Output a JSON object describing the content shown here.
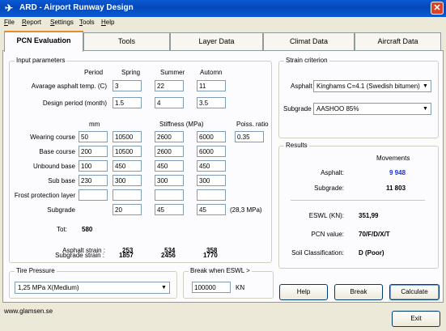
{
  "window": {
    "title": "ARD - Airport Runway Design",
    "close": "✕"
  },
  "menu": [
    "File",
    "Report",
    "Settings",
    "Tools",
    "Help"
  ],
  "tabs": [
    "PCN Evaluation",
    "Tools",
    "Layer Data",
    "Climat Data",
    "Aircraft Data"
  ],
  "input_params": {
    "title": "Input parameters",
    "season_headers": [
      "Period",
      "Spring",
      "Summer",
      "Automn"
    ],
    "avg_temp_label": "Avarage asphalt temp. (C)",
    "avg_temp": [
      "3",
      "22",
      "11"
    ],
    "design_period_label": "Design period (month)",
    "design_period": [
      "1.5",
      "4",
      "3.5"
    ],
    "mm_header": "mm",
    "stiffness_header": "Stiffness (MPa)",
    "poiss_header": "Poiss. ratio",
    "layers": [
      {
        "label": "Wearing course",
        "mm": "50",
        "s": [
          "10500",
          "2600",
          "6000"
        ],
        "poiss": "0.35"
      },
      {
        "label": "Base course",
        "mm": "200",
        "s": [
          "10500",
          "2600",
          "6000"
        ]
      },
      {
        "label": "Unbound base",
        "mm": "100",
        "s": [
          "450",
          "450",
          "450"
        ]
      },
      {
        "label": "Sub base",
        "mm": "230",
        "s": [
          "300",
          "300",
          "300"
        ]
      },
      {
        "label": "Frost protection layer",
        "mm": "",
        "s": [
          "",
          "",
          ""
        ]
      },
      {
        "label": "Subgrade",
        "mm": "",
        "s": [
          "20",
          "45",
          "45"
        ],
        "note": "(28,3 MPa)"
      }
    ],
    "tot_label": "Tot:",
    "tot_value": "580",
    "asphalt_strain_label": "Asphalt strain :",
    "asphalt_strain": [
      "253",
      "534",
      "358"
    ],
    "subgrade_strain_label": "Subgrade strain :",
    "subgrade_strain": [
      "1857",
      "2456",
      "1770"
    ]
  },
  "strain": {
    "title": "Strain criterion",
    "asphalt_label": "Asphalt",
    "asphalt_value": "Kinghams C=4.1 (Swedish bitumen)",
    "subgrade_label": "Subgrade",
    "subgrade_value": "AASHOO 85%"
  },
  "results": {
    "title": "Results",
    "movements_header": "Movements",
    "asphalt_label": "Asphalt:",
    "asphalt_value": "9 948",
    "subgrade_label": "Subgrade:",
    "subgrade_value": "11 803",
    "eswl_label": "ESWL (KN):",
    "eswl_value": "351,99",
    "pcn_label": "PCN value:",
    "pcn_value": "70/F/D/X/T",
    "soil_label": "Soil Classification:",
    "soil_value": "D (Poor)",
    "accent": "#1a2fd6"
  },
  "tire": {
    "title": "Tire Pressure",
    "value": "1,25 MPa  X(Medium)"
  },
  "break": {
    "title": "Break when ESWL >",
    "value": "100000",
    "unit": "KN"
  },
  "buttons": {
    "help": "Help",
    "break": "Break",
    "calculate": "Calculate",
    "exit": "Exit"
  },
  "status": {
    "url": "www.glamsen.se"
  }
}
